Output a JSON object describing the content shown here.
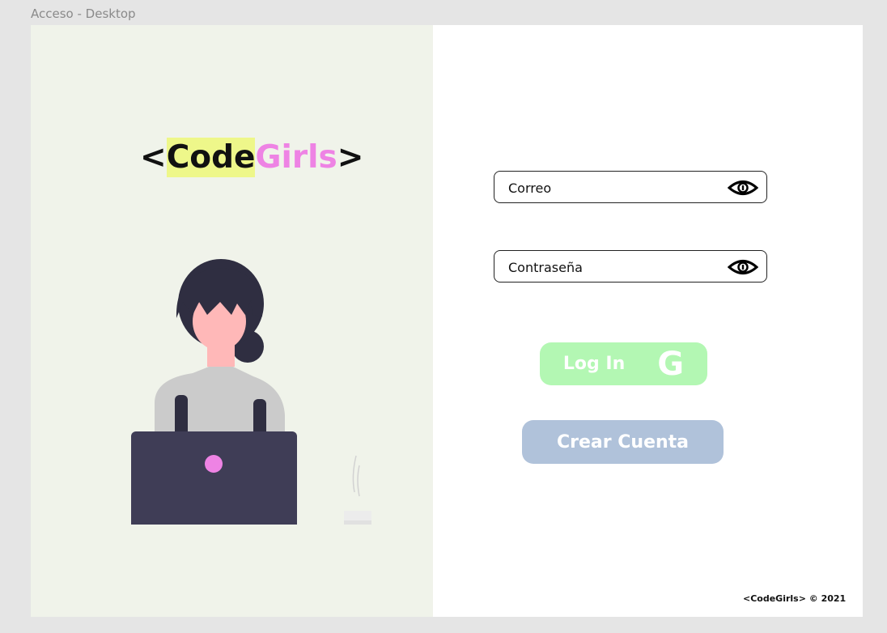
{
  "frame_label": "Acceso - Desktop",
  "logo": {
    "open": "<",
    "code": "Code",
    "girls": "Girls",
    "close": ">"
  },
  "form": {
    "email_placeholder": "Correo",
    "password_placeholder": "Contraseña"
  },
  "buttons": {
    "login_label": "Log In",
    "google_label": "G",
    "create_label": "Crear Cuenta"
  },
  "footer": "<CodeGirls> © 2021",
  "icons": {
    "field_icon": "eye-icon"
  },
  "colors": {
    "left_panel": "#f0f3ea",
    "logo_highlight": "#eef78a",
    "logo_pink": "#ee83e4",
    "login_button": "#b3f7b3",
    "create_button": "#b0c2da",
    "laptop": "#3f3d56"
  }
}
